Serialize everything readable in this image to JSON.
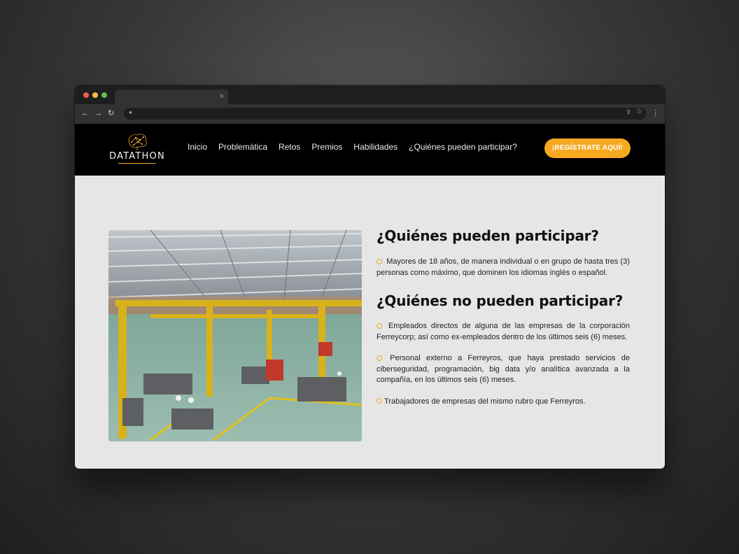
{
  "browser": {
    "tab_close": "×",
    "nav_icons": [
      "back-icon",
      "forward-icon",
      "reload-icon"
    ]
  },
  "header": {
    "logo_text": "DATATHON",
    "nav": [
      "Inicio",
      "Problemática",
      "Retos",
      "Premios",
      "Habilidades",
      "¿Quiénes pueden participar?"
    ],
    "cta_label": "¡REGÍSTRATE AQUÍ!"
  },
  "main": {
    "can_title": "¿Quiénes pueden participar?",
    "can_items": [
      "Mayores de 18 años, de manera individual o en grupo de hasta tres (3) personas como máximo, que dominen los idiomas inglés o español."
    ],
    "cannot_title": "¿Quiénes no pueden participar?",
    "cannot_items": [
      "Empleados directos de alguna de las empresas de la corporación Ferreycorp; así como ex-empleados dentro de los últimos seis (6) meses.",
      "Personal externo a Ferreyros, que haya prestado servicios de ciberseguridad, programación, big data y/o analítica avanzada a la compañía, en los últimos seis (6) meses.",
      "Trabajadores de empresas del mismo rubro que Ferreyros."
    ]
  },
  "colors": {
    "accent": "#f6a821",
    "header_bg": "#000000",
    "page_bg": "#e6e6e6"
  }
}
